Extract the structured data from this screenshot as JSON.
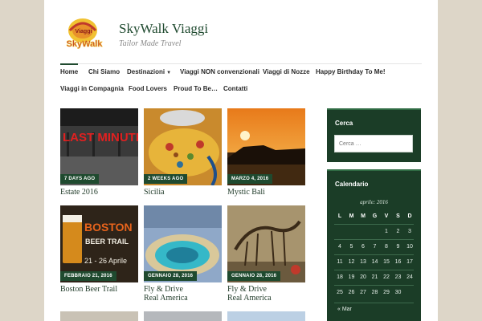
{
  "site": {
    "title": "SkyWalk Viaggi",
    "tagline": "Tailor Made Travel",
    "logo_text_1": "Viaggi",
    "logo_text_2": "SkyWalk"
  },
  "nav": {
    "row1": [
      "Home",
      "Chi Siamo",
      "Destinazioni",
      "Viaggi NON convenzionali",
      "Viaggi di Nozze",
      "Happy Birthday To Me!"
    ],
    "row2": [
      "Viaggi in Compagnia",
      "Food Lovers",
      "Proud To Be…",
      "Contatti"
    ]
  },
  "posts": [
    {
      "title": "Estate 2016",
      "date": "7 DAYS AGO",
      "image_text": "LAST MINUTE NO MORE"
    },
    {
      "title": "Sicilia",
      "date": "2 WEEKS AGO"
    },
    {
      "title": "Mystic Bali",
      "date": "MARZO 4, 2016"
    },
    {
      "title": "Boston Beer Trail",
      "date": "FEBBRAIO 21, 2016",
      "image_text_1": "BOSTON",
      "image_text_2": "BEER TRAIL",
      "image_text_3": "21 - 26 Aprile"
    },
    {
      "title_1": "Fly & Drive",
      "title_2": "Real America",
      "date": "GENNAIO 28, 2016"
    },
    {
      "title_1": "Fly & Drive",
      "title_2": "Real America",
      "date": "GENNAIO 28, 2016"
    }
  ],
  "sidebar": {
    "search": {
      "title": "Cerca",
      "placeholder": "Cerca …"
    },
    "calendar": {
      "title": "Calendario",
      "caption": "aprile: 2016",
      "headers": [
        "L",
        "M",
        "M",
        "G",
        "V",
        "S",
        "D"
      ],
      "weeks": [
        [
          "",
          "",
          "",
          "",
          "1",
          "2",
          "3"
        ],
        [
          "4",
          "5",
          "6",
          "7",
          "8",
          "9",
          "10"
        ],
        [
          "11",
          "12",
          "13",
          "14",
          "15",
          "16",
          "17"
        ],
        [
          "18",
          "19",
          "20",
          "21",
          "22",
          "23",
          "24"
        ],
        [
          "25",
          "26",
          "27",
          "28",
          "29",
          "30",
          ""
        ]
      ],
      "prev": "« Mar"
    }
  },
  "colors": {
    "accent": "#1f4a2f",
    "sidebar_bg": "#1b3d27",
    "page_bg": "#ddd6c8"
  }
}
